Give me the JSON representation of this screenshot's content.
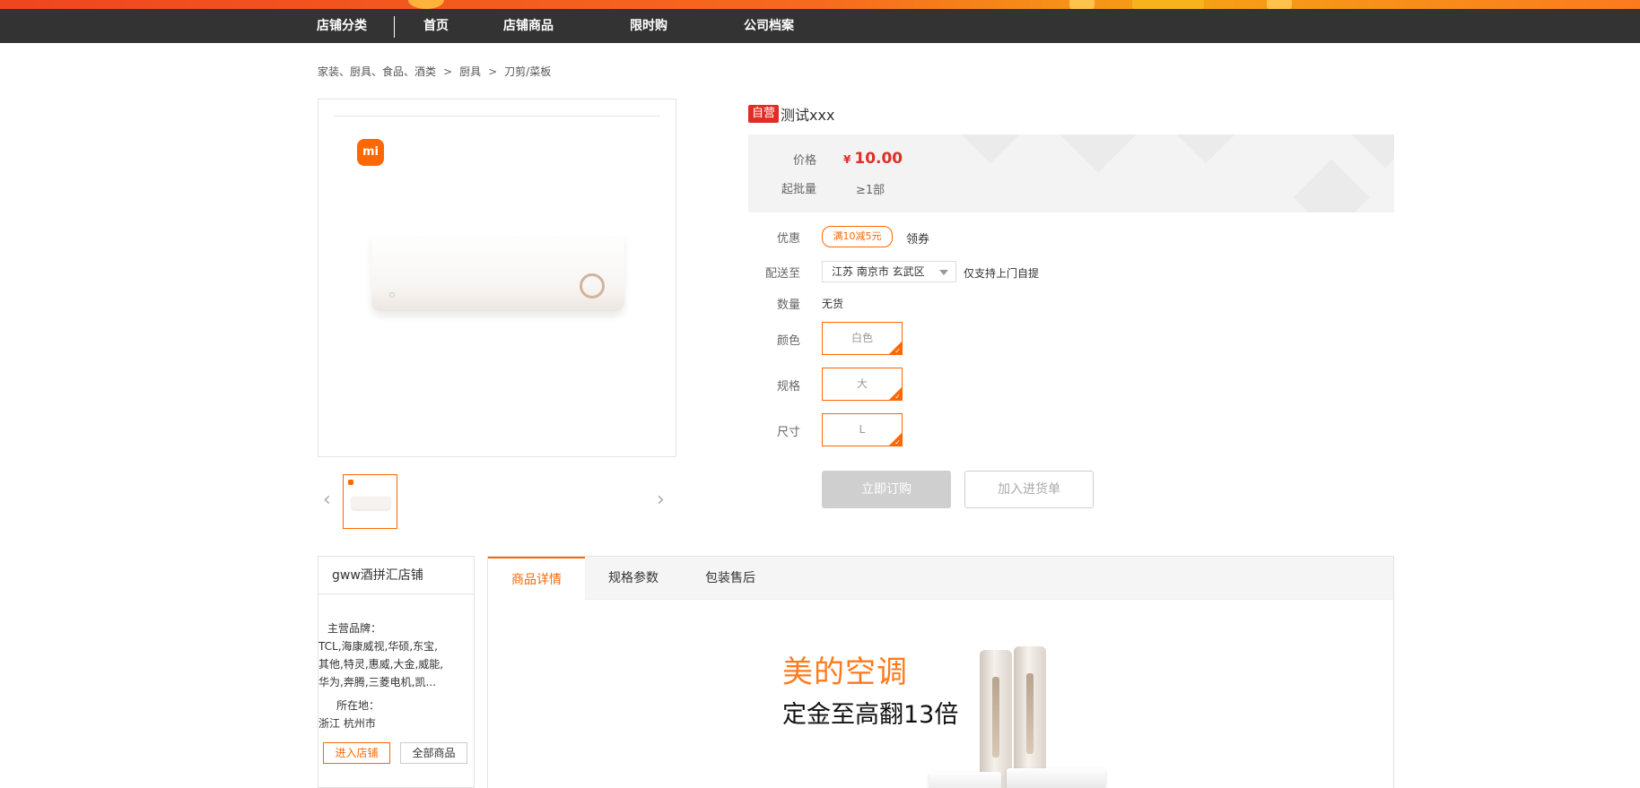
{
  "nav": {
    "items": [
      "店铺分类",
      "首页",
      "店铺商品",
      "限时购",
      "公司档案"
    ]
  },
  "breadcrumb": {
    "items": [
      "家装、厨具、食品、酒类",
      "厨具",
      "刀剪/菜板"
    ],
    "separator": ">"
  },
  "gallery": {
    "brand_logo_text": "mi"
  },
  "product": {
    "badge": "自营",
    "title": "测试xxx",
    "price_label": "价格",
    "currency": "¥",
    "price": "10.00",
    "moq_label": "起批量",
    "moq": "≥1部",
    "coupon_label": "优惠",
    "coupon": "满10减5元",
    "coupon_link": "领券",
    "ship_label": "配送至",
    "region": "江苏 南京市 玄武区",
    "pickup_note": "仅支持上门自提",
    "qty_label": "数量",
    "stock": "无货",
    "options": [
      {
        "label": "颜色",
        "value": "白色"
      },
      {
        "label": "规格",
        "value": "大"
      },
      {
        "label": "尺寸",
        "value": "L"
      }
    ],
    "buy_button": "立即订购",
    "cart_button": "加入进货单"
  },
  "shop": {
    "name": "gww酒拼汇店铺",
    "brands_label": "主营品牌：",
    "brands_lines": [
      "TCL,海康威视,华硕,东宝,",
      "其他,特灵,惠威,大金,威能,",
      "华为,奔腾,三菱电机,凯..."
    ],
    "location_label": "所在地：",
    "location": "浙江 杭州市",
    "enter_button": "进入店铺",
    "all_button": "全部商品"
  },
  "tabs": {
    "items": [
      "商品详情",
      "规格参数",
      "包装售后"
    ],
    "active": 0
  },
  "banner": {
    "title": "美的空调",
    "subtitle": "定金至高翻13倍"
  },
  "colors": {
    "accent": "#ff6700",
    "price_red": "#e02e24",
    "nav_bg": "#333333"
  },
  "icons": [
    "chevron-left-icon",
    "chevron-right-icon",
    "caret-down-icon",
    "check-icon"
  ]
}
